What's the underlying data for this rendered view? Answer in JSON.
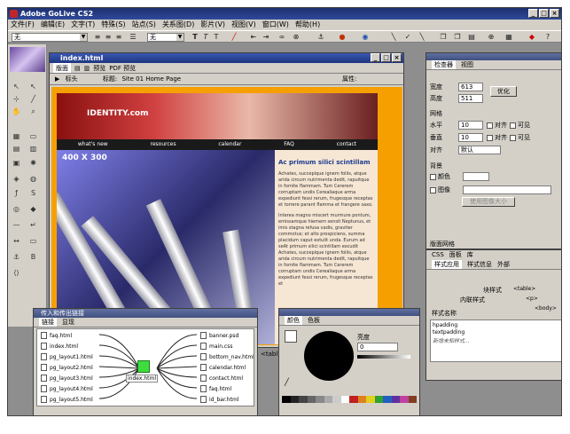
{
  "app": {
    "title": "Adobe GoLive CS2"
  },
  "menu": [
    "文件(F)",
    "编辑(E)",
    "文字(T)",
    "特殊(S)",
    "站点(S)",
    "关系图(D)",
    "影片(V)",
    "视图(V)",
    "窗口(W)",
    "帮助(H)"
  ],
  "toolbar": {
    "style_select": "无",
    "font_select": "无"
  },
  "document": {
    "title": "index.html",
    "tabs": [
      "版面",
      "",
      "",
      "预览",
      "PDF 预览"
    ],
    "breadcrumb": "标头",
    "page_title_label": "标题:",
    "page_title_value": "Site 01 Home Page",
    "attr_label": "属性:"
  },
  "site": {
    "brand": "IDENTITY.com",
    "nav": [
      "what's new",
      "resources",
      "calendar",
      "FAQ",
      "contact"
    ],
    "hero_label": "400 X 300",
    "sidebar_heading": "Ac primum silici scintillam",
    "para1": "Achates, succepique ignem foliis, atque arida circum nutrimenta dedit, rapuitque in fomite flammam. Tum Cererem corruptam undis Cerealiaque arma expediunt fessi rerum, frugesque receptas et torrere parant flamma et frangere saxo.",
    "para2": "Interea magno miscert murmure pontum, emissamque hiemem sensit Neptunus, et imis stagna refusa vadis, graviter commotus; et alto prospiciens, summa placidum caput extulit unda. Eurum ad seAt primum silici scintillam excudit Achates, succepique ignem foliis, atque arida circum nutrimenta dedit, rapuitque in fomite flammam. Tum Cererem corruptam undis Cerealiaque arma expediunt fessi rerum, frugesque receptas et"
  },
  "links_panel": {
    "title": "传入和传出链接",
    "tabs": [
      "链接",
      "显现"
    ],
    "incoming": [
      "faq.html",
      "index.html",
      "pg_layout1.html",
      "pg_layout2.html",
      "pg_layout3.html",
      "pg_layout4.html",
      "pg_layout5.html"
    ],
    "center": "index.html",
    "outgoing": [
      "banner.psd",
      "main.css",
      "bottom_nav.html",
      "calendar.html",
      "contact.html",
      "faq.html",
      "id_bar.html"
    ]
  },
  "props_panel": {
    "tabs": [
      "检查器",
      "视图"
    ],
    "width_label": "宽度",
    "width_value": "613",
    "height_label": "高度",
    "height_value": "511",
    "optimize_button": "优化",
    "grid_label": "网格",
    "h_label": "水平",
    "h_value": "10",
    "v_label": "垂直",
    "v_value": "10",
    "snap_label": "对齐",
    "visible_label": "可见",
    "align_label": "对齐",
    "align_value": "默认",
    "bg_label": "背景",
    "color_label": "颜色",
    "image_label": "图像",
    "use_image_size": "使用图像大小",
    "layout_grid_label": "版面网格"
  },
  "css_panel": {
    "tabs": [
      "CSS",
      "面板",
      "库"
    ],
    "subtabs": [
      "样式应用",
      "样式信息",
      "外部"
    ],
    "h_block": "块样式",
    "h_table": "<table>",
    "h_inline": "内联样式",
    "h_p": "<p>",
    "h_name": "样式名称",
    "h_body": "<body>",
    "rows": [
      "hpadding",
      "textpadding",
      "新增未知样式..."
    ]
  },
  "color_panel": {
    "tabs": [
      "颜色",
      "色板"
    ],
    "brightness_label": "亮度",
    "brightness_value": "0",
    "swatch_colors": [
      "#000000",
      "#222222",
      "#444444",
      "#666666",
      "#888888",
      "#aaaaaa",
      "#cccccc",
      "#ffffff",
      "#c02020",
      "#e08020",
      "#e0d020",
      "#30a030",
      "#2060c0",
      "#6030a0",
      "#c040a0",
      "#804020"
    ]
  },
  "bottom_tag": "<tabl"
}
